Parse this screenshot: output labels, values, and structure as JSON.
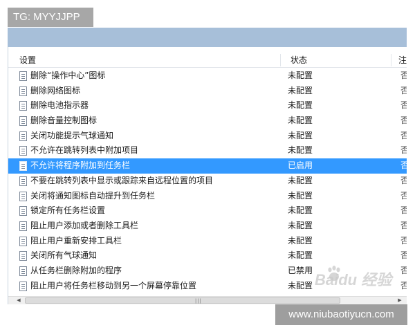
{
  "watermarks": {
    "top": "TG: MYYJJPP",
    "bottom": "www.niubaotiyucn.com",
    "baidu_logo": "Baidu 经验"
  },
  "table": {
    "columns": {
      "setting": "设置",
      "state": "状态",
      "note": "注"
    },
    "rows": [
      {
        "name": "删除“操作中心”图标",
        "state": "未配置",
        "note": "否"
      },
      {
        "name": "删除网络图标",
        "state": "未配置",
        "note": "否"
      },
      {
        "name": "删除电池指示器",
        "state": "未配置",
        "note": "否"
      },
      {
        "name": "删除音量控制图标",
        "state": "未配置",
        "note": "否"
      },
      {
        "name": "关闭功能提示气球通知",
        "state": "未配置",
        "note": "否"
      },
      {
        "name": "不允许在跳转列表中附加项目",
        "state": "未配置",
        "note": "否"
      },
      {
        "name": "不允许将程序附加到任务栏",
        "state": "已启用",
        "note": "否",
        "selected": true
      },
      {
        "name": "不要在跳转列表中显示或跟踪来自远程位置的项目",
        "state": "未配置",
        "note": "否"
      },
      {
        "name": "关闭将通知图标自动提升到任务栏",
        "state": "未配置",
        "note": "否"
      },
      {
        "name": "锁定所有任务栏设置",
        "state": "未配置",
        "note": "否"
      },
      {
        "name": "阻止用户添加或者删除工具栏",
        "state": "未配置",
        "note": "否"
      },
      {
        "name": "阻止用户重新安排工具栏",
        "state": "未配置",
        "note": "否"
      },
      {
        "name": "关闭所有气球通知",
        "state": "未配置",
        "note": "否"
      },
      {
        "name": "从任务栏删除附加的程序",
        "state": "已禁用",
        "note": "否"
      },
      {
        "name": "阻止用户将任务栏移动到另一个屏幕停靠位置",
        "state": "未配置",
        "note": "否"
      }
    ]
  },
  "scrollbar": {
    "left_arrow": "◀",
    "right_arrow": "▶",
    "grip": "|||"
  },
  "colors": {
    "selection": "#3399ff",
    "title_strip": "#a7bfd9"
  }
}
